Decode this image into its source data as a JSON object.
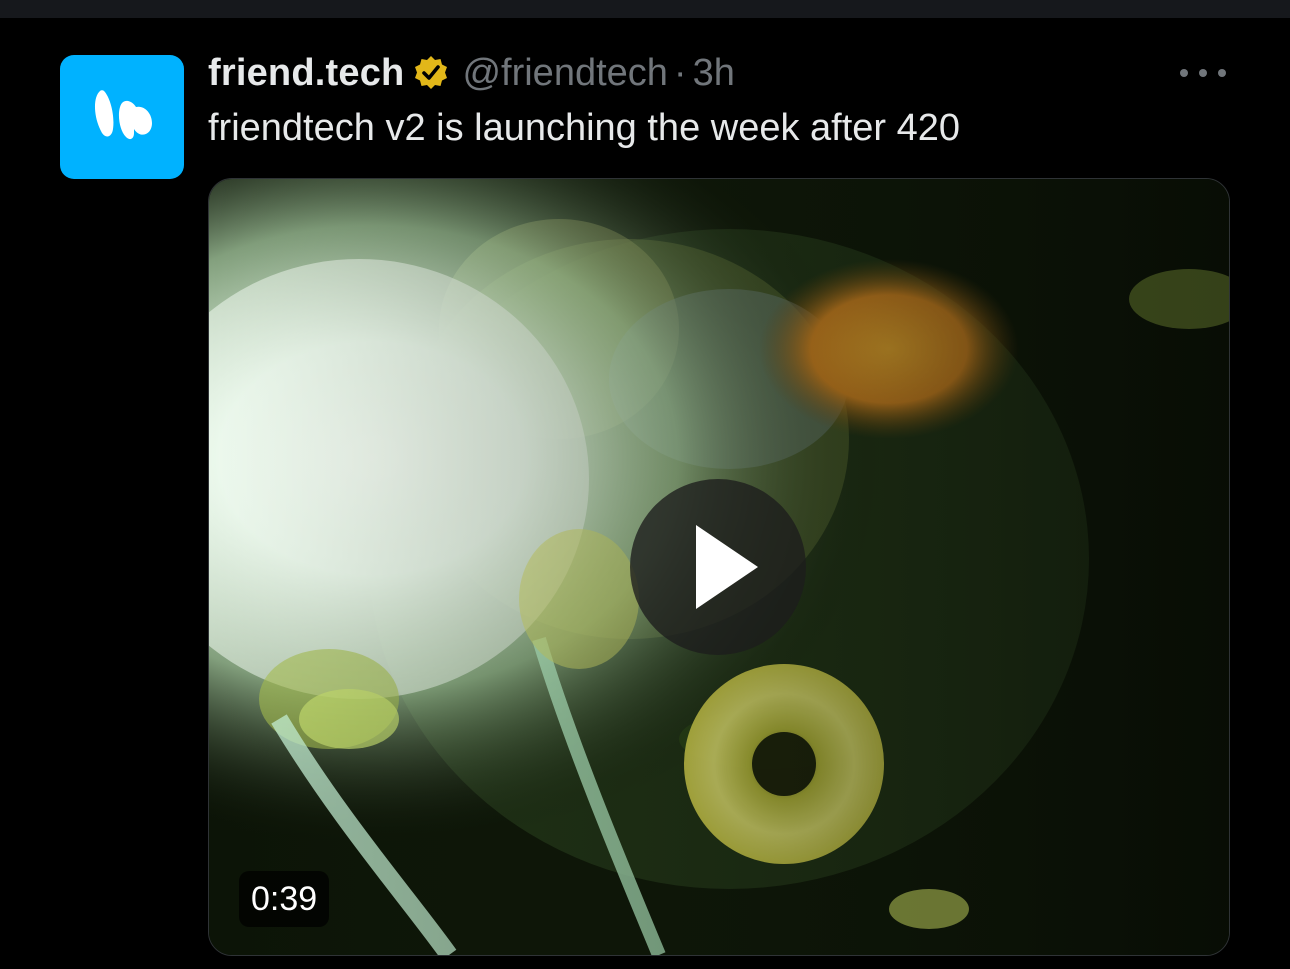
{
  "tweet": {
    "display_name": "friend.tech",
    "handle": "@friendtech",
    "separator": "·",
    "time": "3h",
    "text": "friendtech v2 is launching the week after 420",
    "verified": true
  },
  "media": {
    "type": "video",
    "duration": "0:39"
  },
  "icons": {
    "avatar": "friendtech-logo-icon",
    "verified": "verified-badge-icon",
    "more": "more-options-icon",
    "play": "play-icon"
  },
  "colors": {
    "background": "#000000",
    "text_primary": "#e7e9ea",
    "text_secondary": "#71767b",
    "avatar_bg": "#00b2ff",
    "verified_badge": "#e2b719"
  }
}
